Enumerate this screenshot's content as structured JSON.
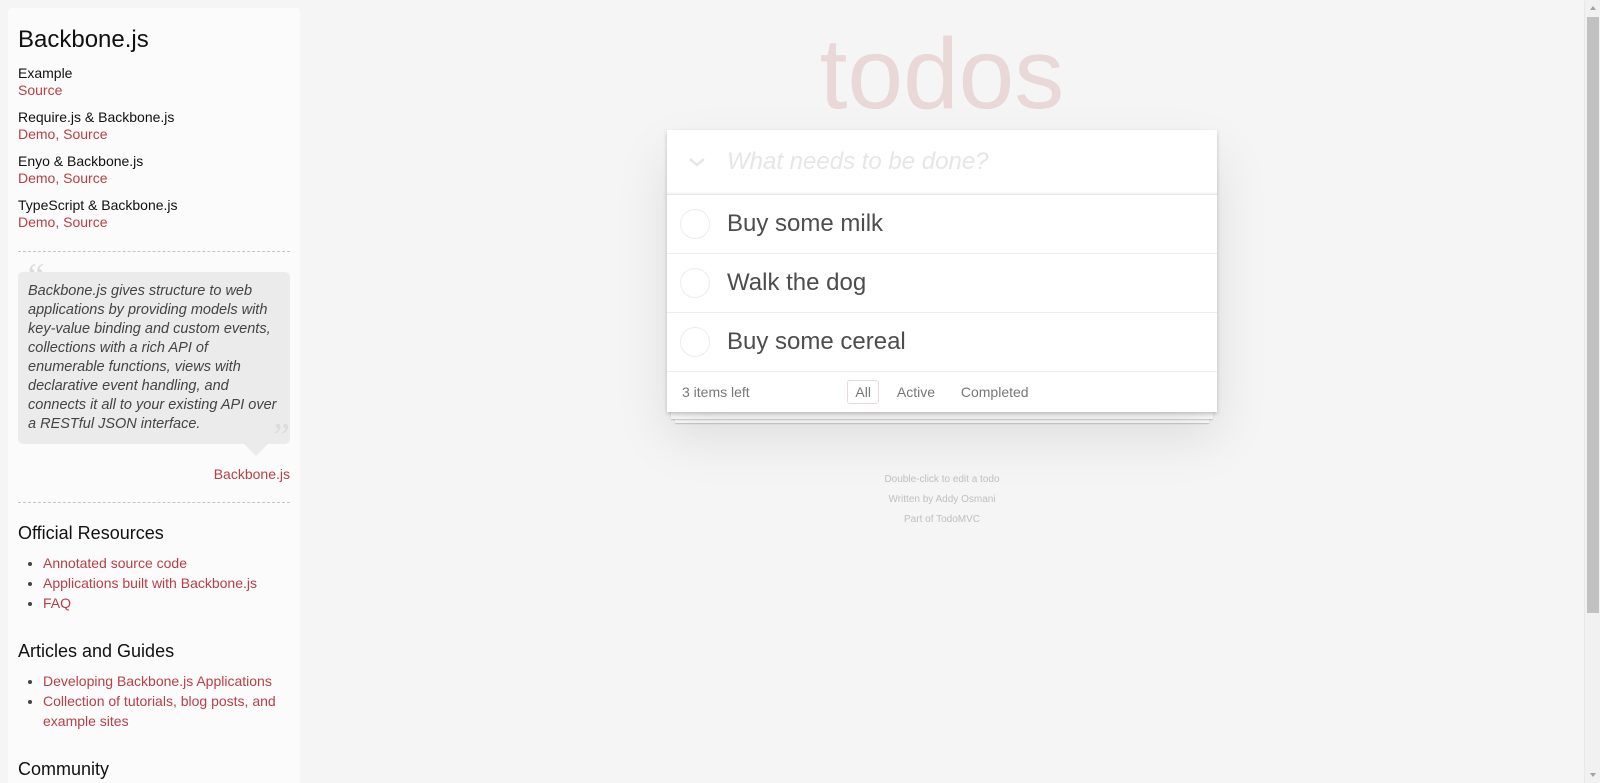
{
  "sidebar": {
    "title": "Backbone.js",
    "examples": [
      {
        "name": "Example",
        "links": [
          "Source"
        ]
      },
      {
        "name": "Require.js & Backbone.js",
        "links": [
          "Demo",
          "Source"
        ]
      },
      {
        "name": "Enyo & Backbone.js",
        "links": [
          "Demo",
          "Source"
        ]
      },
      {
        "name": "TypeScript & Backbone.js",
        "links": [
          "Demo",
          "Source"
        ]
      }
    ],
    "quote": "Backbone.js gives structure to web applications by providing models with key-value binding and custom events, collections with a rich API of enumerable functions, views with declarative event handling, and connects it all to your existing API over a RESTful JSON interface.",
    "quote_source": "Backbone.js",
    "official_heading": "Official Resources",
    "official_links": [
      "Annotated source code",
      "Applications built with Backbone.js",
      "FAQ"
    ],
    "articles_heading": "Articles and Guides",
    "articles_links": [
      "Developing Backbone.js Applications",
      "Collection of tutorials, blog posts, and example sites"
    ],
    "community_heading": "Community"
  },
  "app": {
    "title": "todos",
    "input_placeholder": "What needs to be done?",
    "todos": [
      "Buy some milk",
      "Walk the dog",
      "Buy some cereal"
    ],
    "count_text": "3 items left",
    "filters": [
      "All",
      "Active",
      "Completed"
    ],
    "selected_filter": "All"
  },
  "info": {
    "line1": "Double-click to edit a todo",
    "line2": "Written by Addy Osmani",
    "line3": "Part of TodoMVC"
  },
  "colors": {
    "accent": "#b83f45",
    "title": "rgba(175,47,47,0.15)"
  }
}
